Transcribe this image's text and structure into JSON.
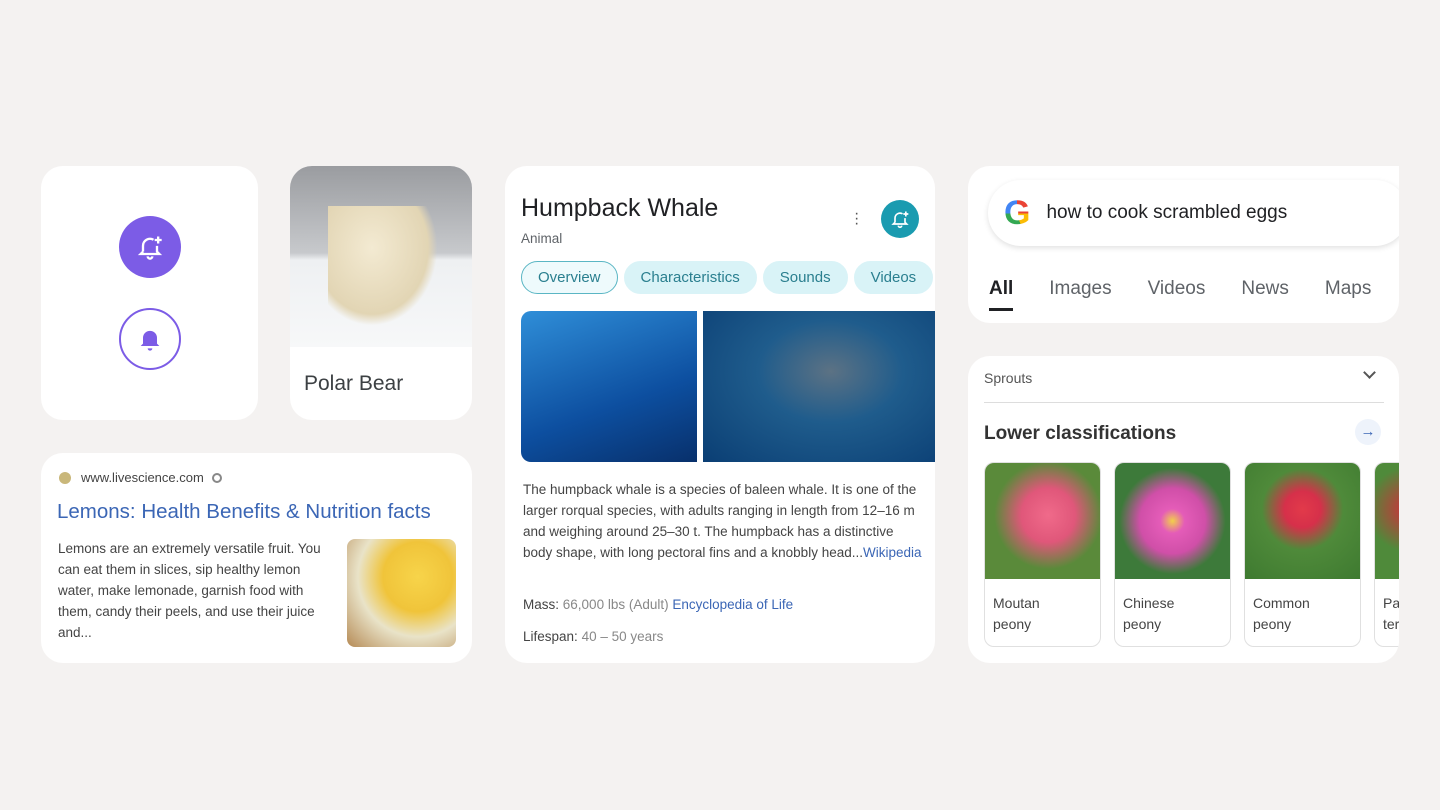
{
  "bell_card": {
    "icons": [
      "bell-plus-icon",
      "bell-icon"
    ],
    "accent": "#7c5ce6"
  },
  "polar_bear": {
    "label": "Polar Bear"
  },
  "lemons": {
    "site": "www.livescience.com",
    "title": "Lemons: Health Benefits & Nutrition facts",
    "snippet": "Lemons are an extremely versatile fruit. You can eat them in slices, sip healthy lemon water, make lemonade, garnish food with them, candy their peels, and use their juice and..."
  },
  "whale": {
    "title": "Humpback Whale",
    "subtitle": "Animal",
    "chips": [
      "Overview",
      "Characteristics",
      "Sounds",
      "Videos"
    ],
    "description": "The humpback whale is a species of baleen whale. It is one of the larger rorqual species, with adults ranging in length from 12–16 m and weighing around 25–30 t. The humpback has a distinctive body shape, with long pectoral fins and a knobbly head...",
    "source": "Wikipedia",
    "mass_label": "Mass:",
    "mass_value": "66,000 lbs (Adult)",
    "mass_source": "Encyclopedia of Life",
    "lifespan_label": "Lifespan:",
    "lifespan_value": "40 – 50 years",
    "accent": "#1a9bb0"
  },
  "search": {
    "query": "how to cook scrambled eggs",
    "tabs": [
      "All",
      "Images",
      "Videos",
      "News",
      "Maps"
    ]
  },
  "sprouts": {
    "header": "Sprouts",
    "section_title": "Lower classifications",
    "items": [
      {
        "l1": "Moutan",
        "l2": "peony"
      },
      {
        "l1": "Chinese",
        "l2": "peony"
      },
      {
        "l1": "Common",
        "l2": "peony"
      },
      {
        "l1": "Pa",
        "l2": "ter"
      }
    ]
  }
}
